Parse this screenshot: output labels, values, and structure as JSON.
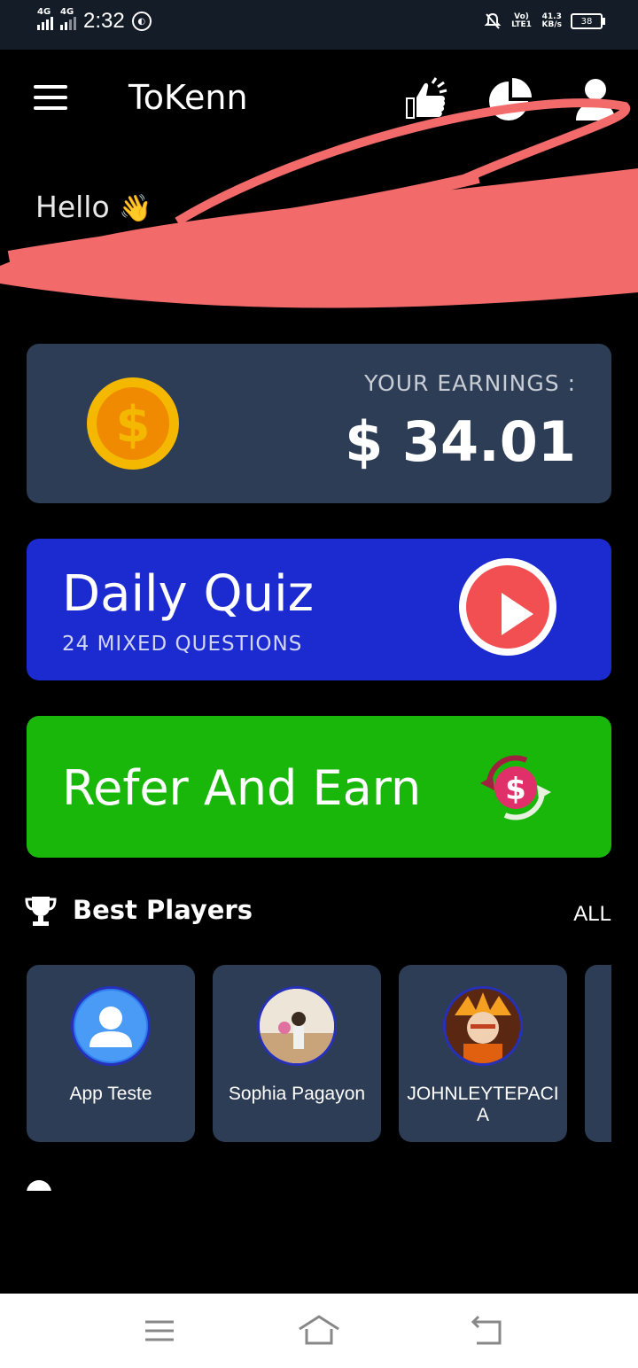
{
  "status_bar": {
    "net1": "4G",
    "net2": "4G",
    "time": "2:32",
    "volte": "Vo) LTE1",
    "speed_value": "41.3",
    "speed_unit": "KB/s",
    "battery": "38"
  },
  "header": {
    "title": "ToKenn",
    "icons": [
      "menu-icon",
      "thumbs-up-icon",
      "pie-chart-icon",
      "user-icon"
    ]
  },
  "greeting": {
    "text": "Hello",
    "emoji": "👋"
  },
  "earnings": {
    "label": "YOUR EARNINGS :",
    "value": "$ 34.01"
  },
  "daily_quiz": {
    "title": "Daily Quiz",
    "subtitle": "24 MIXED QUESTIONS"
  },
  "refer": {
    "title": "Refer And Earn"
  },
  "best_players": {
    "title": "Best Players",
    "all_label": "ALL",
    "players": [
      {
        "name": "App Teste"
      },
      {
        "name": "Sophia Pagayon"
      },
      {
        "name": "JOHNLEYTEPACIA"
      }
    ]
  },
  "colors": {
    "background": "#000000",
    "card": "#2d3d55",
    "quiz": "#1c2bd0",
    "refer": "#1ab70b",
    "play": "#f24f52",
    "coin": "#f5b800",
    "scribble": "#f26a6a"
  }
}
